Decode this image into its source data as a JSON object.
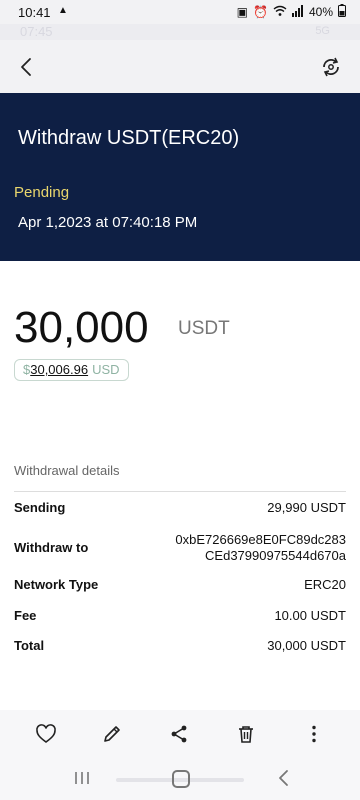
{
  "status_bar": {
    "time": "10:41",
    "battery": "40%",
    "icons": [
      "notification-icon",
      "lock-icon",
      "alarm-icon",
      "wifi-icon",
      "signal-icon",
      "battery-icon"
    ]
  },
  "ghost_status": {
    "time": "07:45",
    "network": "5G"
  },
  "app_bar": {
    "back_icon": "back-arrow-icon",
    "action_icon": "sync-icon"
  },
  "transaction": {
    "title": "Withdraw USDT(ERC20)",
    "status": "Pending",
    "date": "Apr 1,2023 at 07:40:18 PM",
    "amount": "30,000",
    "unit": "USDT",
    "usd_symbol": "$",
    "usd_value": "30,006.96",
    "usd_currency": "USD"
  },
  "details": {
    "title": "Withdrawal details",
    "rows": [
      {
        "label": "Sending",
        "value": "29,990 USDT"
      },
      {
        "label": "Withdraw to",
        "value_line1": "0xbE726669e8E0FC89dc283",
        "value_line2": "CEd37990975544d670a"
      },
      {
        "label": "Network Type",
        "value": "ERC20"
      },
      {
        "label": "Fee",
        "value": "10.00 USDT"
      },
      {
        "label": "Total",
        "value": "30,000 USDT"
      }
    ]
  },
  "toolbar": {
    "icons": [
      "heart-icon",
      "pencil-icon",
      "share-icon",
      "trash-icon",
      "more-vertical-icon"
    ]
  },
  "nav": {
    "icons": [
      "recent-apps-icon",
      "home-icon",
      "nav-back-icon"
    ]
  },
  "colors": {
    "hero_bg": "#0e1f44",
    "pending": "#e9d66d",
    "usd_accent": "#8fb3a3"
  }
}
